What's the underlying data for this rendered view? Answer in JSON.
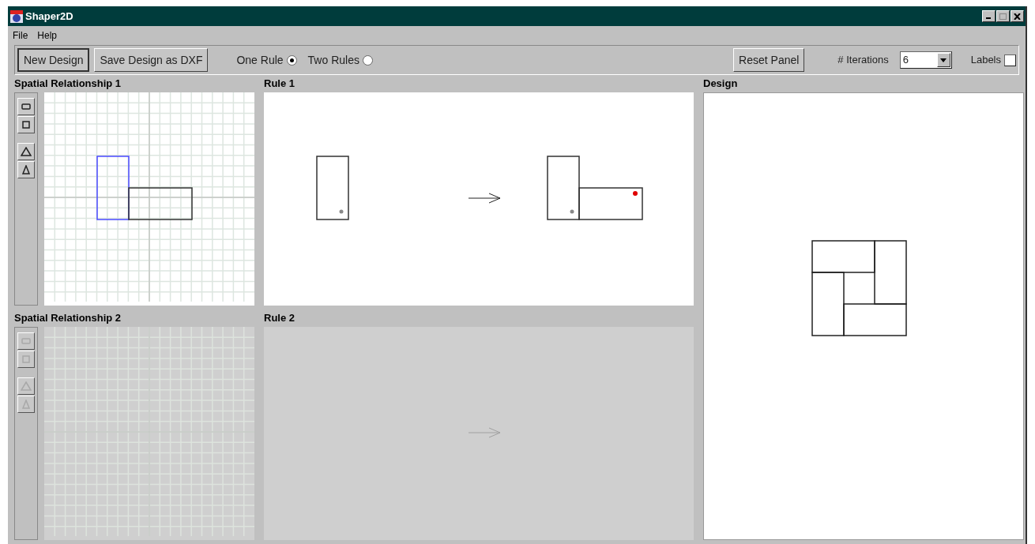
{
  "window": {
    "title": "Shaper2D"
  },
  "menu": [
    "File",
    "Help"
  ],
  "toolbar": {
    "buttons": [
      {
        "label": "New Design",
        "pressed": true
      },
      {
        "label": "Save Design as DXF",
        "pressed": false
      }
    ],
    "rule_options": [
      {
        "label": "One Rule",
        "selected": true
      },
      {
        "label": "Two Rules",
        "selected": false
      }
    ],
    "reset_button": "Reset Panel",
    "iterations_label": "# Iterations",
    "iterations_value": "6",
    "labels_label": "Labels",
    "labels_checked": false
  },
  "spatial_relationships": [
    {
      "title": "Spatial Relationship 1",
      "disabled": false
    },
    {
      "title": "Spatial Relationship 2",
      "disabled": true
    }
  ],
  "rules": [
    {
      "title": "Rule 1",
      "disabled": false
    },
    {
      "title": "Rule 2",
      "disabled": true
    }
  ],
  "design": {
    "title": "Design"
  }
}
